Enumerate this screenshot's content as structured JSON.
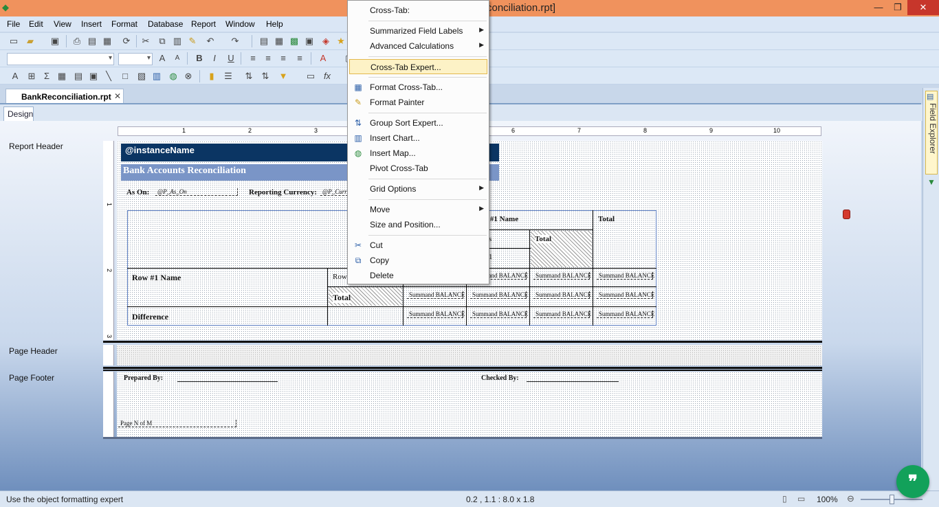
{
  "titlebar": {
    "title": "conciliation.rpt]",
    "minimize": "—",
    "maximize": "❐",
    "close": "✕"
  },
  "menubar": [
    "File",
    "Edit",
    "View",
    "Insert",
    "Format",
    "Database",
    "Report",
    "Window",
    "Help"
  ],
  "document_tab": {
    "label": "BankReconciliation.rpt",
    "close": "✕"
  },
  "view_tab": "Design",
  "field_explorer": "Field Explorer",
  "ruler": {
    "h_marks": [
      "1",
      "2",
      "3",
      "6",
      "7",
      "8",
      "9",
      "10"
    ],
    "v_report_header": [
      "1",
      "2",
      "3"
    ]
  },
  "sections": {
    "report_header": "Report Header",
    "page_header": "Page Header",
    "page_footer": "Page Footer"
  },
  "report": {
    "instance_name": "@instanceName",
    "title": "Bank Accounts Reconciliation",
    "as_on_label": "As On:",
    "as_on_field": "@P_As_On",
    "reporting_currency_label": "Reporting Currency:",
    "currency_field": "@P_Curr",
    "prepared_by": "Prepared By:",
    "checked_by": "Checked By:",
    "page_n_of_m": "Page N of M"
  },
  "crosstab": {
    "column1_name": "n #1 Name",
    "total": "Total",
    "row1_name": "Row #1 Name",
    "row_small": "Row",
    "difference": "Difference",
    "summary": "Summand BALANCE",
    "small_s": "s",
    "small_1": "1"
  },
  "context_menu": {
    "header": "Cross-Tab:",
    "items": [
      {
        "label": "Summarized Field Labels",
        "submenu": true
      },
      {
        "label": "Advanced Calculations",
        "submenu": true
      },
      {
        "label": "Cross-Tab Expert...",
        "highlighted": true
      },
      {
        "label": "Format Cross-Tab...",
        "icon": "format-crosstab-icon"
      },
      {
        "label": "Format Painter",
        "icon": "format-painter-icon"
      },
      {
        "label": "Group Sort Expert...",
        "icon": "group-sort-icon"
      },
      {
        "label": "Insert Chart...",
        "icon": "chart-icon"
      },
      {
        "label": "Insert Map...",
        "icon": "map-icon"
      },
      {
        "label": "Pivot Cross-Tab"
      },
      {
        "label": "Grid Options",
        "submenu": true
      },
      {
        "label": "Move",
        "submenu": true
      },
      {
        "label": "Size and Position..."
      },
      {
        "label": "Cut",
        "icon": "scissors-icon"
      },
      {
        "label": "Copy",
        "icon": "copy-icon"
      },
      {
        "label": "Delete"
      }
    ]
  },
  "statusbar": {
    "message": "Use the object formatting expert",
    "coords": "0.2 , 1.1 : 8.0 x 1.8",
    "zoom": "100%",
    "zoom_level": 0.5
  },
  "chat_bubble": "❞"
}
